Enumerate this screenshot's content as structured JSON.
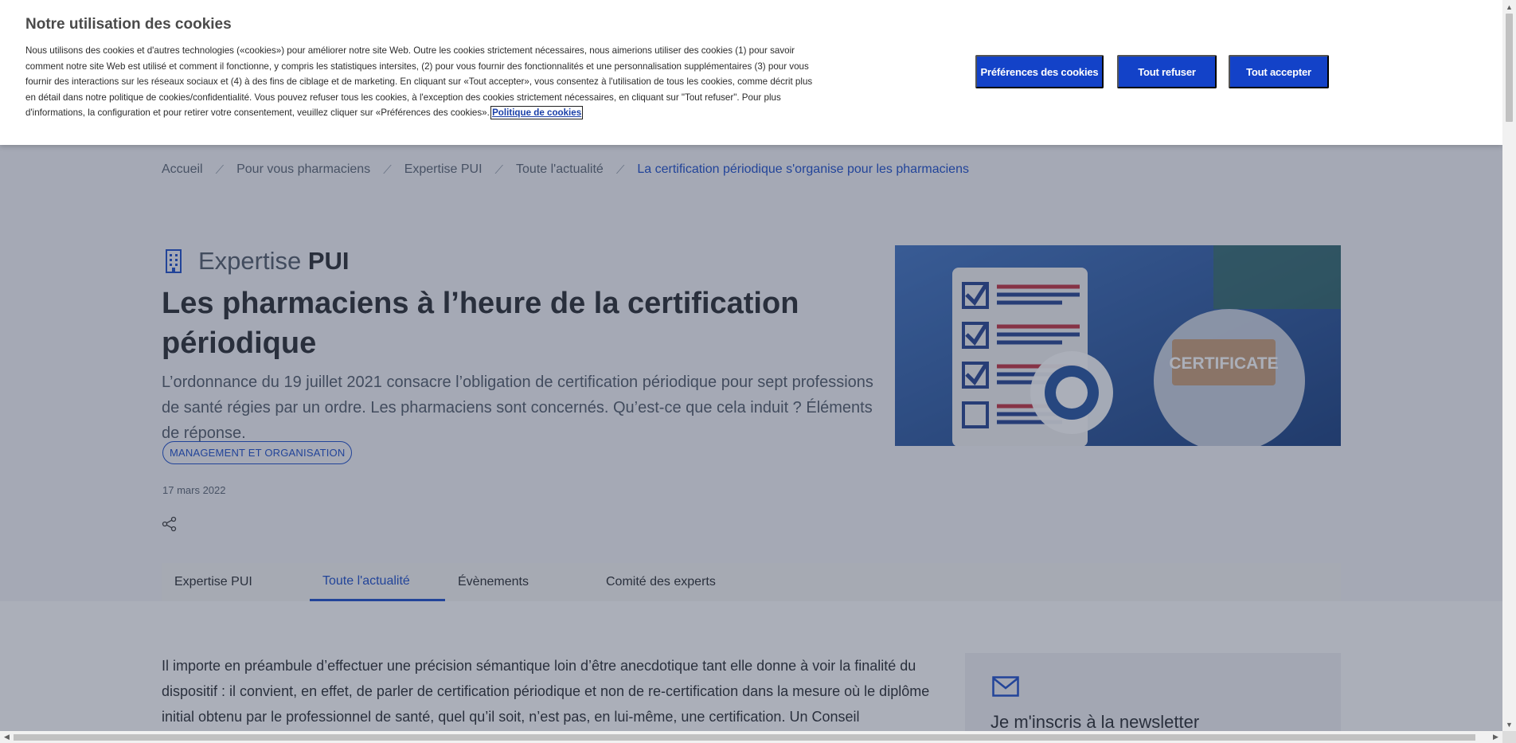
{
  "cookie_banner": {
    "title": "Notre utilisation des cookies",
    "text": "Nous utilisons des cookies et d'autres technologies («cookies») pour améliorer notre site Web. Outre les cookies strictement nécessaires, nous aimerions utiliser des cookies (1) pour savoir comment notre site Web est utilisé et comment il fonctionne, y compris les statistiques intersites, (2) pour vous fournir des fonctionnalités et une personnalisation supplémentaires (3) pour vous fournir des interactions sur les réseaux sociaux et (4) à des fins de ciblage et de marketing. En cliquant sur «Tout accepter», vous consentez à l'utilisation de tous les cookies, comme décrit plus en détail dans notre politique de cookies/confidentialité. Vous pouvez refuser tous les cookies, à l'exception des cookies strictement nécessaires, en cliquant sur \"Tout refuser\". Pour plus d'informations, la configuration et pour retirer votre consentement, veuillez cliquer sur «Préférences des cookies».",
    "policy_link": "Politique de cookies",
    "buttons": {
      "preferences": "Préférences des cookies",
      "refuse": "Tout refuser",
      "accept": "Tout accepter"
    }
  },
  "breadcrumb": {
    "items": [
      "Accueil",
      "Pour vous pharmaciens",
      "Expertise PUI",
      "Toute l'actualité"
    ],
    "current": "La certification périodique s'organise pour les pharmaciens",
    "separator": "⟋"
  },
  "article": {
    "kicker_light": "Expertise",
    "kicker_bold": "PUI",
    "title": "Les pharmaciens à l’heure de la certification périodique",
    "lead": "L’ordonnance du 19 juillet 2021 consacre l’obligation de certification périodique pour sept professions de santé régies par un ordre. Les pharmaciens sont concernés. Qu’est-ce que cela induit ? Éléments de réponse.",
    "tag": "MANAGEMENT ET ORGANISATION",
    "date": "17 mars 2022",
    "image_text": "CERTIFICATE",
    "body": "Il importe en préambule d’effectuer une précision sémantique loin d’être anecdotique tant elle donne à voir la finalité du dispositif : il convient, en effet, de parler de certification périodique et non de re-certification dans la mesure où le diplôme initial obtenu par le professionnel de santé, quel qu’il soit, n’est pas, en lui-même, une certification. Un Conseil"
  },
  "tabs": [
    {
      "label": "Expertise PUI",
      "active": false
    },
    {
      "label": "Toute l'actualité",
      "active": true
    },
    {
      "label": "Évènements",
      "active": false
    },
    {
      "label": "Comité des experts",
      "active": false
    }
  ],
  "newsletter": {
    "title": "Je m'inscris à la newsletter"
  },
  "colors": {
    "accent": "#1342c8",
    "overlay": "rgba(55,65,88,0.42)"
  }
}
